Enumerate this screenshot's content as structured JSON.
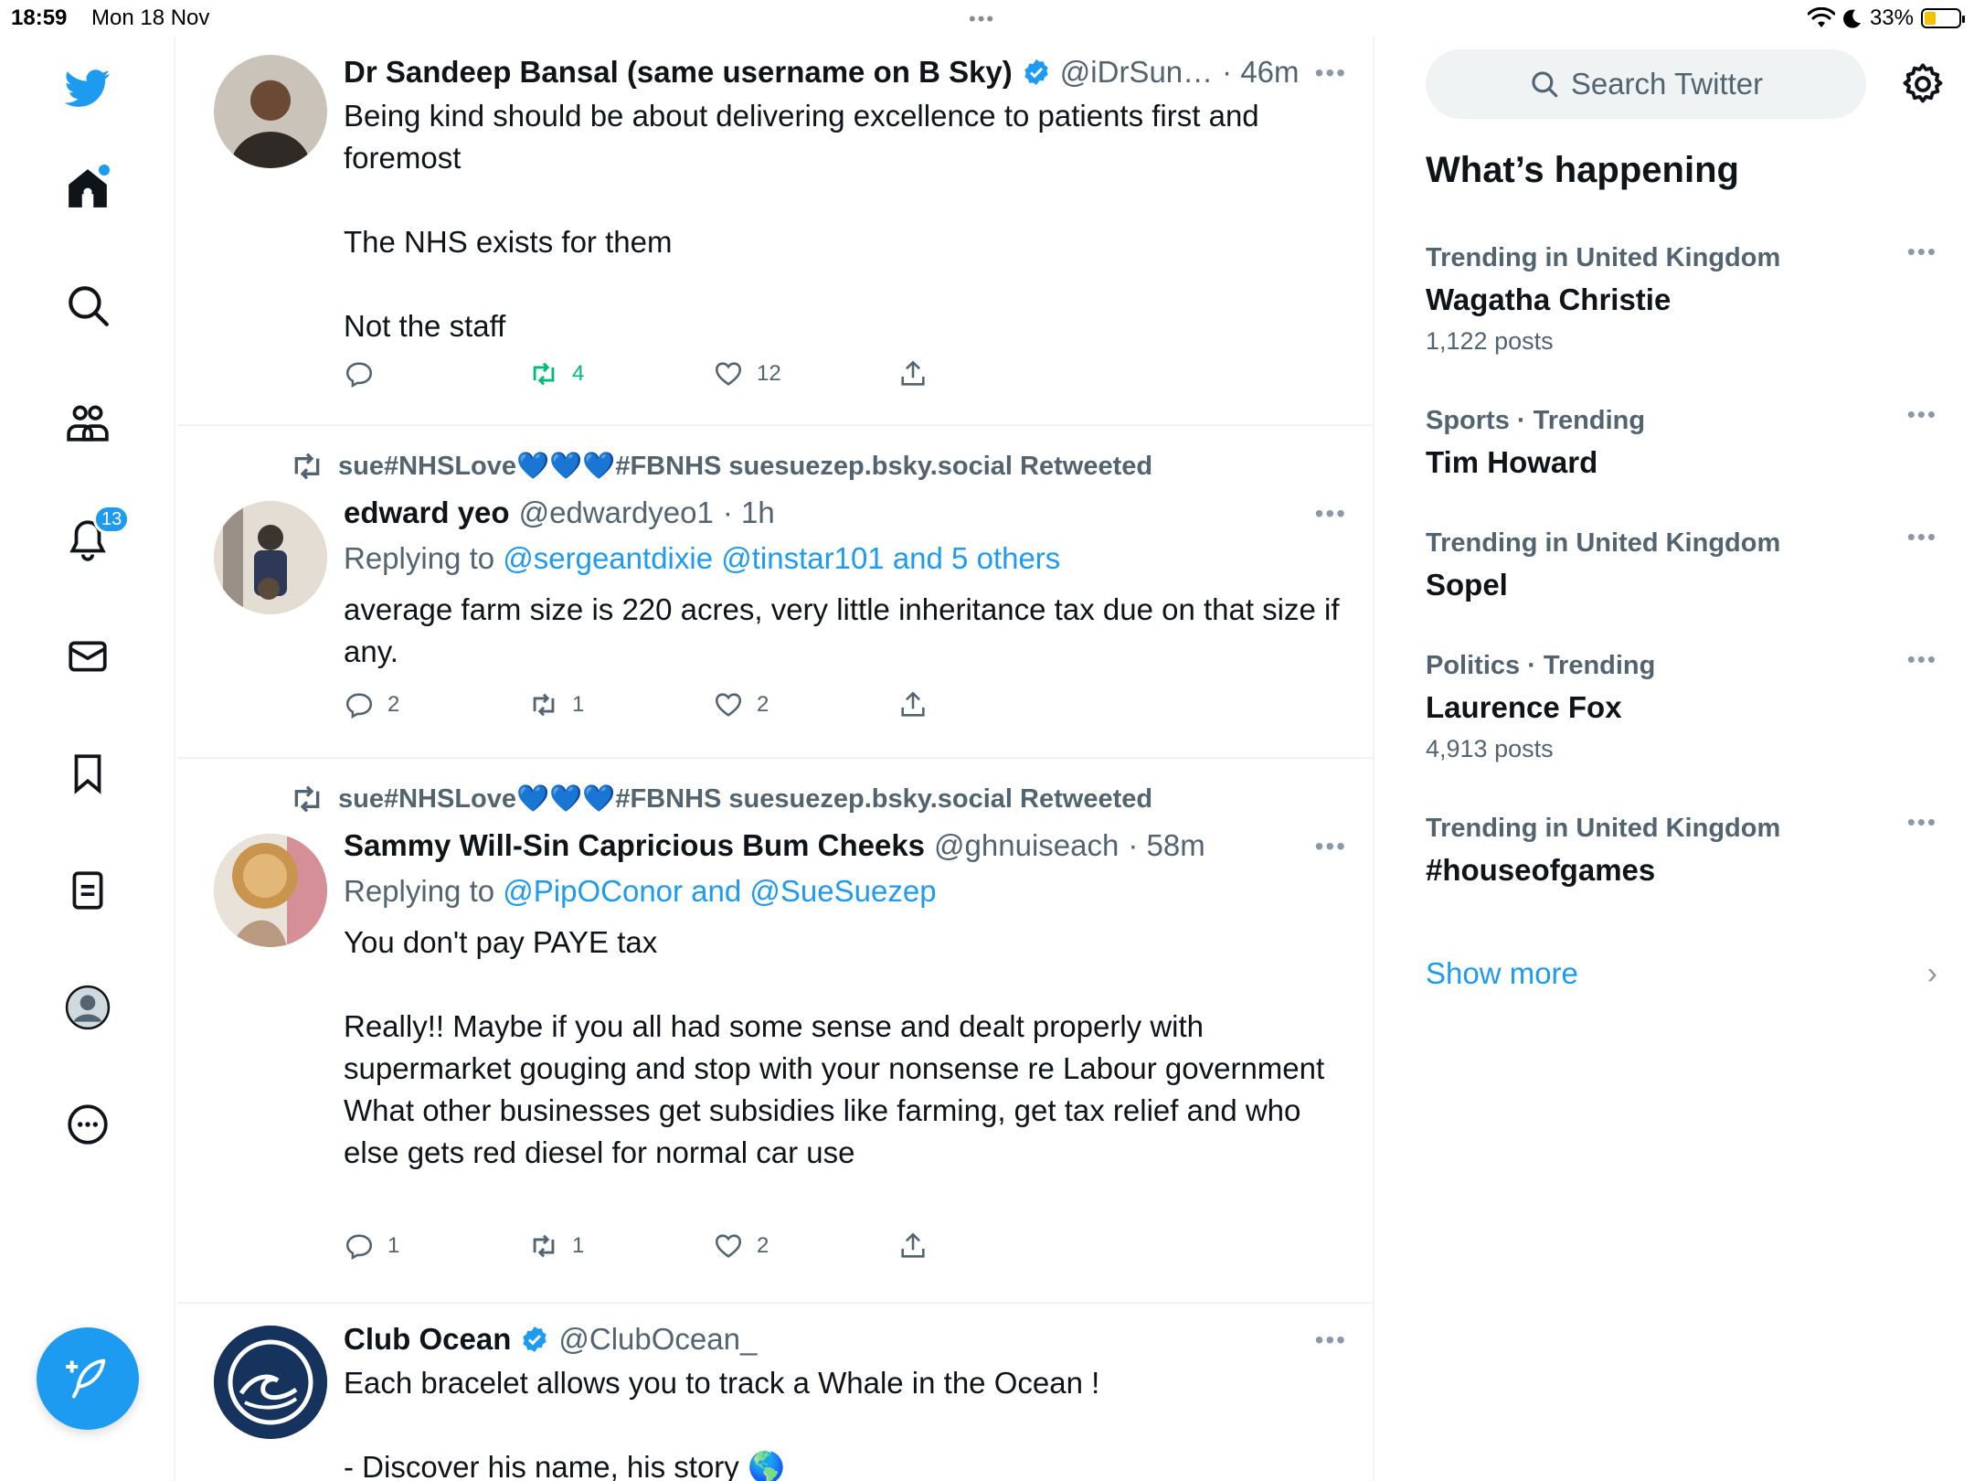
{
  "status_bar": {
    "time": "18:59",
    "date": "Mon 18 Nov",
    "battery": "33%",
    "center_dots": "•••"
  },
  "nav": {
    "notifications_count": "13"
  },
  "tweets": [
    {
      "name": "Dr Sandeep Bansal (same username on B Sky)",
      "verified": true,
      "handle": "@iDrSun…",
      "time": "· 46m",
      "text": "Being kind should be about delivering excellence to patients first and foremost\n\nThe NHS exists for them\n\nNot the staff",
      "reply_count": "",
      "retweet_count": "4",
      "like_count": "12",
      "retweeted_by_viewer": true
    },
    {
      "retweeted_by": "sue#NHSLove💙💙💙#FBNHS suesuezep.bsky.social Retweeted",
      "name": "edward yeo",
      "handle": "@edwardyeo1",
      "time": "· 1h",
      "reply_prefix": "Replying to ",
      "reply_targets": "@sergeantdixie @tinstar101 and 5 others",
      "text": "average farm size is 220 acres, very little inheritance tax due on that size if any.",
      "reply_count": "2",
      "retweet_count": "1",
      "like_count": "2"
    },
    {
      "retweeted_by": "sue#NHSLove💙💙💙#FBNHS suesuezep.bsky.social Retweeted",
      "name": "Sammy Will-Sin Capricious Bum Cheeks",
      "handle": "@ghnuiseach",
      "time": "· 58m",
      "reply_prefix": "Replying to ",
      "reply_targets": "@PipOConor and @SueSuezep",
      "text": "You don't pay PAYE tax\n\nReally!! Maybe if you all had some sense and dealt properly with supermarket gouging and stop with your nonsense re Labour government\nWhat other businesses get subsidies like farming, get tax relief and who else gets red diesel for normal car use",
      "reply_count": "1",
      "retweet_count": "1",
      "like_count": "2"
    },
    {
      "name": "Club Ocean",
      "verified": true,
      "handle": "@ClubOcean_",
      "time": "",
      "text": "Each bracelet allows you to track a Whale in the Ocean !\n\n- Discover his name, his story 🌎"
    }
  ],
  "sidebar": {
    "search_placeholder": "Search Twitter",
    "section_title": "What’s happening",
    "trends": [
      {
        "context": "Trending in United Kingdom",
        "name": "Wagatha Christie",
        "count": "1,122 posts"
      },
      {
        "context": "Sports · Trending",
        "name": "Tim Howard",
        "count": ""
      },
      {
        "context": "Trending in United Kingdom",
        "name": "Sopel",
        "count": ""
      },
      {
        "context": "Politics · Trending",
        "name": "Laurence Fox",
        "count": "4,913 posts"
      },
      {
        "context": "Trending in United Kingdom",
        "name": "#houseofgames",
        "count": ""
      }
    ],
    "show_more": "Show more",
    "more_glyph": "•••"
  },
  "colors": {
    "accent": "#1d9bf0",
    "retweet_green": "#00ba7c",
    "secondary_text": "#536471",
    "divider": "#eff3f4"
  }
}
